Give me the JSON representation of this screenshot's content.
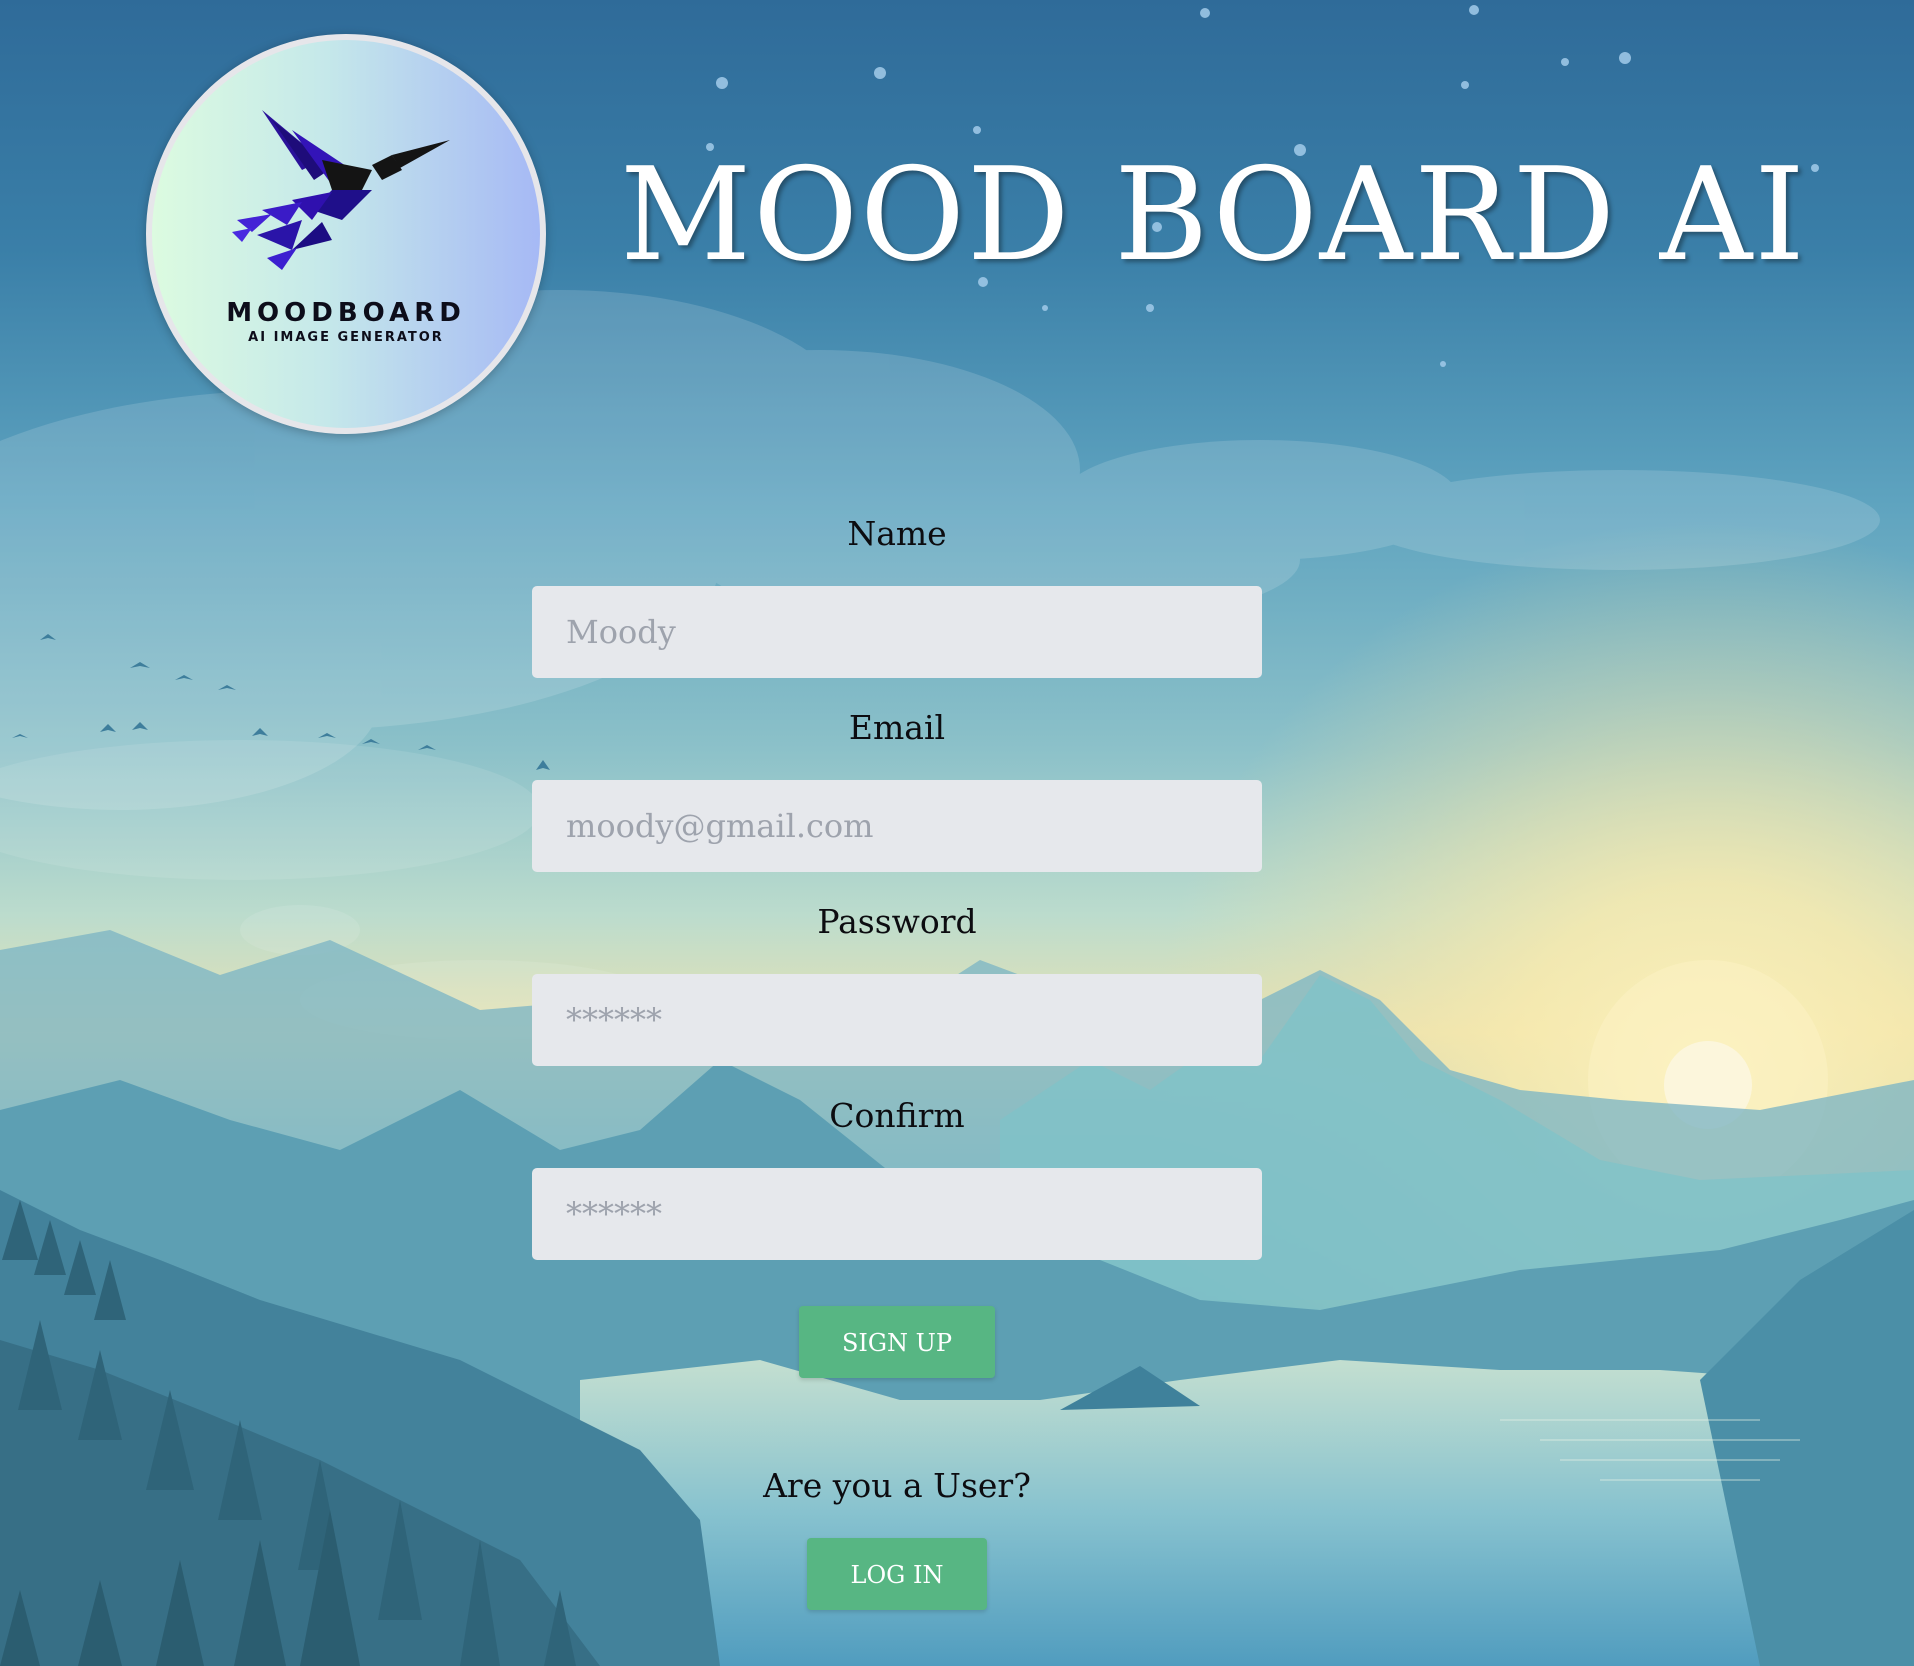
{
  "app": {
    "title": "MOOD BOARD AI"
  },
  "logo": {
    "name": "MOODBOARD",
    "subtitle": "AI IMAGE GENERATOR",
    "icon": "hummingbird-icon"
  },
  "form": {
    "name": {
      "label": "Name",
      "placeholder": "Moody"
    },
    "email": {
      "label": "Email",
      "placeholder": "moody@gmail.com"
    },
    "password": {
      "label": "Password",
      "placeholder": "******"
    },
    "confirm": {
      "label": "Confirm",
      "placeholder": "******"
    },
    "signup_label": "SIGN UP"
  },
  "login": {
    "question": "Are you a User?",
    "button_label": "LOG IN"
  },
  "colors": {
    "button": "#57b683",
    "input_bg": "#e6e8ec",
    "sky_top": "#2f6b99"
  }
}
